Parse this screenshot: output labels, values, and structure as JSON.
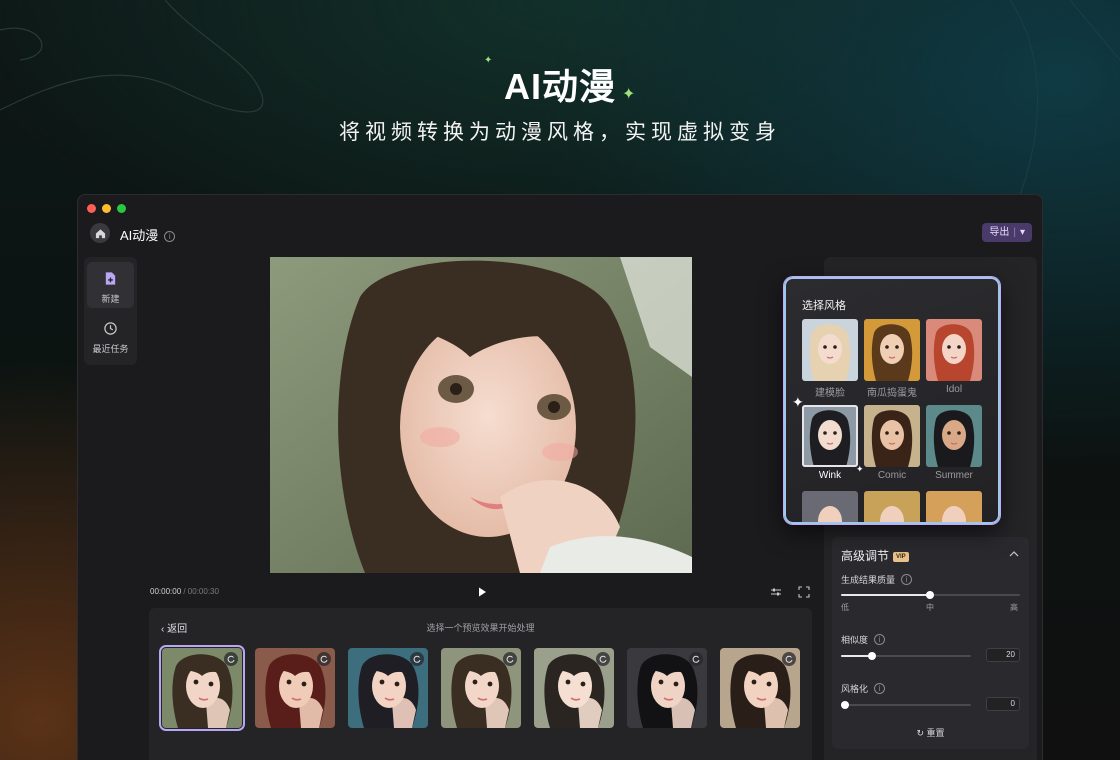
{
  "hero": {
    "title": "AI动漫",
    "subtitle": "将视频转换为动漫风格，实现虚拟变身"
  },
  "app": {
    "name": "AI动漫",
    "export_label": "导出",
    "accent_color": "#b9a6f5"
  },
  "sidebar": {
    "items": [
      {
        "label": "新建",
        "icon": "new-file-icon",
        "active": true
      },
      {
        "label": "最近任务",
        "icon": "history-icon",
        "active": false
      }
    ]
  },
  "player": {
    "current_time": "00:00:00",
    "total_time": " / 00:00:30"
  },
  "strip": {
    "back_label": "返回",
    "hint": "选择一个预览效果开始处理",
    "thumbnail_count": 7,
    "selected_index": 0
  },
  "style_popup": {
    "title": "选择风格",
    "styles": [
      {
        "name": "建模脸"
      },
      {
        "name": "南瓜捣蛋鬼"
      },
      {
        "name": "Idol"
      },
      {
        "name": "Wink",
        "active": true
      },
      {
        "name": "Comic"
      },
      {
        "name": "Summer"
      }
    ]
  },
  "advanced": {
    "title": "高级调节",
    "vip_badge": "VIP",
    "quality": {
      "label": "生成结果质量",
      "low": "低",
      "mid": "中",
      "high": "高",
      "level": "中"
    },
    "similarity": {
      "label": "相似度",
      "value": "20"
    },
    "stylization": {
      "label": "风格化",
      "value": "0"
    },
    "reset_label": "重置"
  }
}
